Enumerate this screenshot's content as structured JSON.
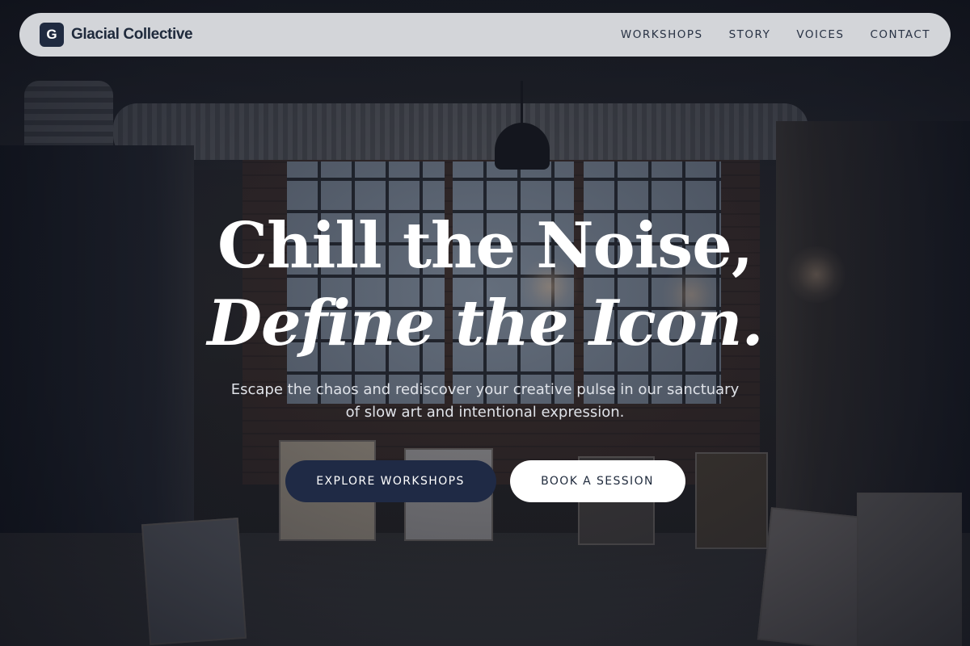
{
  "brand": {
    "mark": "G",
    "name": "Glacial Collective"
  },
  "nav": {
    "links": [
      "WORKSHOPS",
      "STORY",
      "VOICES",
      "CONTACT"
    ]
  },
  "hero": {
    "headline_line1": "Chill the Noise,",
    "headline_line2": "Define the Icon.",
    "subtext": "Escape the chaos and rediscover your creative pulse in our sanctuary of slow art and intentional expression."
  },
  "cta": {
    "primary_label": "EXPLORE WORKSHOPS",
    "secondary_label": "BOOK A SESSION"
  },
  "colors": {
    "brand_dark": "#1f2a45",
    "navbar_bg": "#e2e4e7",
    "text_light": "#ffffff"
  }
}
